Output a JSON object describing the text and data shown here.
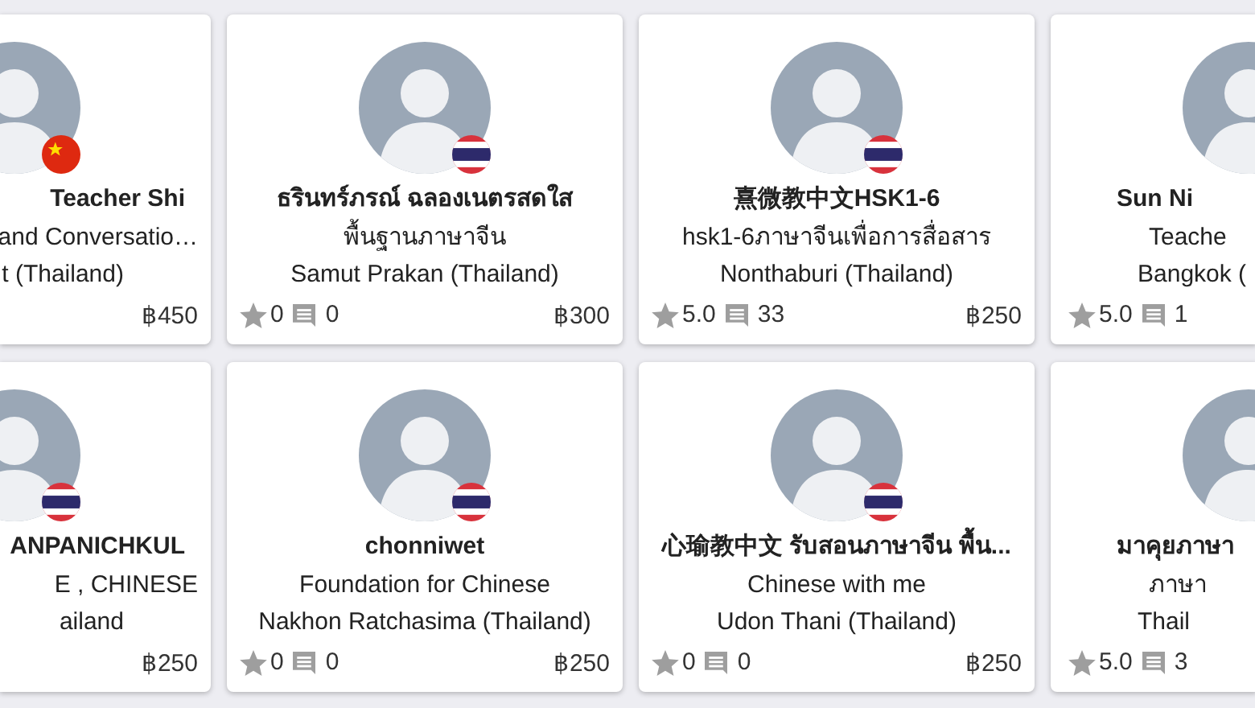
{
  "cards": [
    {
      "kind": "clipped_left",
      "name": "Teacher Shi",
      "subtitle": "and Conversatio…",
      "location": "t (Thailand)",
      "price": "฿450",
      "flag": {
        "kind": "china"
      }
    },
    {
      "kind": "full",
      "name": "ธรินทร์ภรณ์ ฉลองเนตรสดใส",
      "subtitle": "พื้นฐานภาษาจีน",
      "location": "Samut Prakan (Thailand)",
      "rating": "0",
      "reviews": "0",
      "price": "฿300",
      "flag": {
        "kind": "thailand"
      }
    },
    {
      "kind": "full",
      "name": "熹微教中文HSK1-6",
      "subtitle": "hsk1-6ภาษาจีนเพื่อการสื่อสาร",
      "location": "Nonthaburi (Thailand)",
      "rating": "5.0",
      "reviews": "33",
      "price": "฿250",
      "flag": {
        "kind": "thailand"
      }
    },
    {
      "kind": "clipped_right",
      "name": "Sun Ni",
      "subtitle": "Teache",
      "location": "Bangkok (",
      "rating": "5.0",
      "reviews": "1"
    },
    {
      "kind": "clipped_left",
      "name": "ANPANICHKUL",
      "subtitle": "E , CHINESE",
      "location": "ailand",
      "price": "฿250",
      "flag": {
        "kind": "thailand"
      }
    },
    {
      "kind": "full",
      "name": "chonniwet",
      "subtitle": "Foundation for Chinese",
      "location": "Nakhon Ratchasima (Thailand)",
      "rating": "0",
      "reviews": "0",
      "price": "฿250",
      "flag": {
        "kind": "thailand"
      }
    },
    {
      "kind": "full",
      "name": "心瑜教中文 รับสอนภาษาจีน พื้น...",
      "subtitle": "Chinese with me",
      "location": "Udon Thani (Thailand)",
      "rating": "0",
      "reviews": "0",
      "price": "฿250",
      "flag": {
        "kind": "thailand"
      }
    },
    {
      "kind": "clipped_right",
      "name": "มาคุยภาษา",
      "subtitle": "ภาษา",
      "location": "Thail",
      "rating": "5.0",
      "reviews": "3"
    }
  ]
}
